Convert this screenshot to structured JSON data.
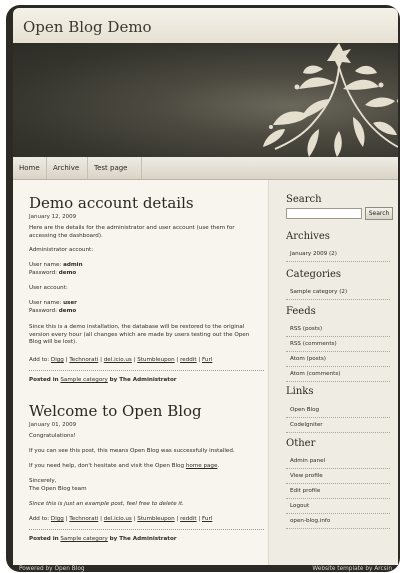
{
  "site": {
    "title": "Open Blog Demo"
  },
  "nav": [
    "Home",
    "Archive",
    "Test page"
  ],
  "posts": [
    {
      "title": "Demo account details",
      "date": "January 12, 2009",
      "intro": "Here are the details for the administrator and user account (use them for accessing the dashboard).",
      "admin_heading": "Administrator account:",
      "admin_username_label": "User name:",
      "admin_username": "admin",
      "admin_password_label": "Password:",
      "admin_password": "demo",
      "user_heading": "User account:",
      "user_username_label": "User name:",
      "user_username": "user",
      "user_password_label": "Password:",
      "user_password": "demo",
      "note": "Since this is a demo installation, the database will be restored to the original version every hour (all changes which are made by users testing out the Open Blog will be lost).",
      "share_label": "Add to:",
      "share_links": [
        "Digg",
        "Technorati",
        "del.icio.us",
        "Stumbleupon",
        "reddit",
        "Furl"
      ],
      "posted_in_label": "Posted in",
      "category": "Sample category",
      "by_text": "by The Administrator"
    },
    {
      "title": "Welcome to Open Blog",
      "date": "January 01, 2009",
      "greeting": "Congratulations!",
      "installed": "If you can see this post, this means Open Blog was successfully installed.",
      "help_text": "If you need help, don't hesitate and visit the Open Blog",
      "help_link": "home page",
      "help_end": ".",
      "sincerely": "Sincerely,",
      "team": "The Open Blog team",
      "example_note": "Since this is just an example post, feel free to delete it.",
      "share_label": "Add to:",
      "share_links": [
        "Digg",
        "Technorati",
        "del.icio.us",
        "Stumbleupon",
        "reddit",
        "Furl"
      ],
      "posted_in_label": "Posted in",
      "category": "Sample category",
      "by_text": "by The Administrator"
    }
  ],
  "sidebar": {
    "search": {
      "heading": "Search",
      "button": "Search",
      "value": ""
    },
    "archives": {
      "heading": "Archives",
      "items": [
        "January 2009 (2)"
      ]
    },
    "categories": {
      "heading": "Categories",
      "items": [
        "Sample category (2)"
      ]
    },
    "feeds": {
      "heading": "Feeds",
      "items": [
        "RSS (posts)",
        "RSS (comments)",
        "Atom (posts)",
        "Atom (comments)"
      ]
    },
    "links": {
      "heading": "Links",
      "items": [
        "Open Blog",
        "CodeIgniter"
      ]
    },
    "other": {
      "heading": "Other",
      "items": [
        "Admin panel",
        "View profile",
        "Edit profile",
        "Logout",
        "open-blog.info"
      ]
    }
  },
  "footer": {
    "left": "Powered by Open Blog",
    "right": "Website template by Arcsin"
  },
  "colors": {
    "frame": "#2b2a24",
    "content_bg": "#f7f5ee",
    "sidebar_bg": "#efece3",
    "banner_dark": "#34332c",
    "ornament": "#e4dfcf"
  }
}
